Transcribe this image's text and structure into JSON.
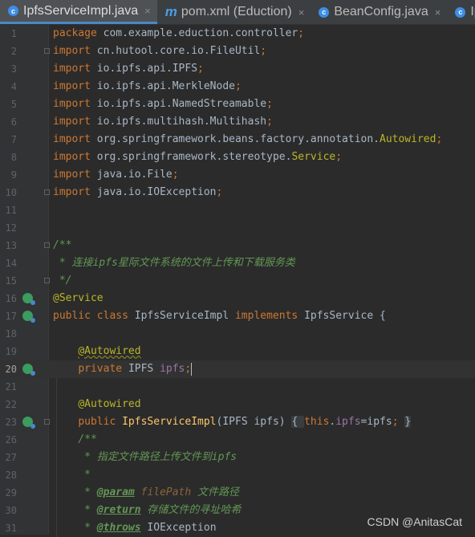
{
  "tabs": [
    {
      "label": "IpfsServiceImpl.java",
      "icon": "java-class-icon",
      "active": true
    },
    {
      "label": "pom.xml (Eduction)",
      "icon": "maven-icon",
      "active": false
    },
    {
      "label": "BeanConfig.java",
      "icon": "java-class-icon",
      "active": false
    },
    {
      "label": "Ipfs",
      "icon": "java-class-icon",
      "active": false
    }
  ],
  "close_glyph": "×",
  "editor": {
    "current_line": "20",
    "lines": [
      {
        "n": "1",
        "tokens": [
          {
            "t": "package ",
            "c": "kw"
          },
          {
            "t": "com.example.eduction.controller",
            "c": ""
          },
          {
            "t": ";",
            "c": "kw"
          }
        ]
      },
      {
        "n": "2",
        "tokens": [
          {
            "t": "import ",
            "c": "kw"
          },
          {
            "t": "cn.hutool.core.io.FileUtil",
            "c": ""
          },
          {
            "t": ";",
            "c": "kw"
          }
        ]
      },
      {
        "n": "3",
        "tokens": [
          {
            "t": "import ",
            "c": "kw"
          },
          {
            "t": "io.ipfs.api.IPFS",
            "c": ""
          },
          {
            "t": ";",
            "c": "kw"
          }
        ]
      },
      {
        "n": "4",
        "tokens": [
          {
            "t": "import ",
            "c": "kw"
          },
          {
            "t": "io.ipfs.api.MerkleNode",
            "c": ""
          },
          {
            "t": ";",
            "c": "kw"
          }
        ]
      },
      {
        "n": "5",
        "tokens": [
          {
            "t": "import ",
            "c": "kw"
          },
          {
            "t": "io.ipfs.api.NamedStreamable",
            "c": ""
          },
          {
            "t": ";",
            "c": "kw"
          }
        ]
      },
      {
        "n": "6",
        "tokens": [
          {
            "t": "import ",
            "c": "kw"
          },
          {
            "t": "io.ipfs.multihash.Multihash",
            "c": ""
          },
          {
            "t": ";",
            "c": "kw"
          }
        ]
      },
      {
        "n": "7",
        "tokens": [
          {
            "t": "import ",
            "c": "kw"
          },
          {
            "t": "org.springframework.beans.factory.annotation.",
            "c": ""
          },
          {
            "t": "Autowired",
            "c": "ann"
          },
          {
            "t": ";",
            "c": "kw"
          }
        ]
      },
      {
        "n": "8",
        "tokens": [
          {
            "t": "import ",
            "c": "kw"
          },
          {
            "t": "org.springframework.stereotype.",
            "c": ""
          },
          {
            "t": "Service",
            "c": "ann"
          },
          {
            "t": ";",
            "c": "kw"
          }
        ]
      },
      {
        "n": "9",
        "tokens": [
          {
            "t": "import ",
            "c": "kw"
          },
          {
            "t": "java.io.File",
            "c": ""
          },
          {
            "t": ";",
            "c": "kw"
          }
        ]
      },
      {
        "n": "10",
        "tokens": [
          {
            "t": "import ",
            "c": "kw"
          },
          {
            "t": "java.io.IOException",
            "c": ""
          },
          {
            "t": ";",
            "c": "kw"
          }
        ]
      },
      {
        "n": "11",
        "tokens": []
      },
      {
        "n": "12",
        "tokens": []
      },
      {
        "n": "13",
        "tokens": [
          {
            "t": "/**",
            "c": "cmt"
          }
        ]
      },
      {
        "n": "14",
        "tokens": [
          {
            "t": " * 连接ipfs星际文件系统的文件上传和下载服务类",
            "c": "cmt"
          }
        ]
      },
      {
        "n": "15",
        "tokens": [
          {
            "t": " */",
            "c": "cmt"
          }
        ]
      },
      {
        "n": "16",
        "tokens": [
          {
            "t": "@Service",
            "c": "ann"
          }
        ]
      },
      {
        "n": "17",
        "tokens": [
          {
            "t": "public class ",
            "c": "kw"
          },
          {
            "t": "IpfsServiceImpl ",
            "c": ""
          },
          {
            "t": "implements ",
            "c": "kw"
          },
          {
            "t": "IpfsService {",
            "c": ""
          }
        ]
      },
      {
        "n": "18",
        "tokens": []
      },
      {
        "n": "19",
        "tokens": [
          {
            "t": "    ",
            "c": ""
          },
          {
            "t": "@Autowired",
            "c": "ann err"
          }
        ]
      },
      {
        "n": "20",
        "tokens": [
          {
            "t": "    ",
            "c": ""
          },
          {
            "t": "private ",
            "c": "kw"
          },
          {
            "t": "IPFS ",
            "c": ""
          },
          {
            "t": "ipfs",
            "c": "fld"
          },
          {
            "t": ";",
            "c": "kw"
          }
        ]
      },
      {
        "n": "21",
        "tokens": []
      },
      {
        "n": "22",
        "tokens": [
          {
            "t": "    ",
            "c": ""
          },
          {
            "t": "@Autowired",
            "c": "ann"
          }
        ]
      },
      {
        "n": "23",
        "tokens": [
          {
            "t": "    ",
            "c": ""
          },
          {
            "t": "public ",
            "c": "kw"
          },
          {
            "t": "IpfsServiceImpl",
            "c": "fn"
          },
          {
            "t": "(IPFS ipfs) ",
            "c": ""
          },
          {
            "t": "{ ",
            "c": "foldbox"
          },
          {
            "t": "this",
            "c": "kw"
          },
          {
            "t": ".",
            "c": ""
          },
          {
            "t": "ipfs",
            "c": "fld"
          },
          {
            "t": "=ipfs",
            "c": ""
          },
          {
            "t": "; ",
            "c": "kw"
          },
          {
            "t": "}",
            "c": "foldbox"
          }
        ]
      },
      {
        "n": "26",
        "tokens": [
          {
            "t": "    ",
            "c": ""
          },
          {
            "t": "/**",
            "c": "cmt"
          }
        ]
      },
      {
        "n": "27",
        "tokens": [
          {
            "t": "     * 指定文件路径上传文件到ipfs",
            "c": "cmt"
          }
        ]
      },
      {
        "n": "28",
        "tokens": [
          {
            "t": "     *",
            "c": "cmt"
          }
        ]
      },
      {
        "n": "29",
        "tokens": [
          {
            "t": "     * ",
            "c": "cmt"
          },
          {
            "t": "@param",
            "c": "tag"
          },
          {
            "t": " ",
            "c": "cmt"
          },
          {
            "t": "filePath",
            "c": "pname"
          },
          {
            "t": " 文件路径",
            "c": "cmt"
          }
        ]
      },
      {
        "n": "30",
        "tokens": [
          {
            "t": "     * ",
            "c": "cmt"
          },
          {
            "t": "@return",
            "c": "tag"
          },
          {
            "t": " 存储文件的寻址哈希",
            "c": "cmt"
          }
        ]
      },
      {
        "n": "31",
        "tokens": [
          {
            "t": "     * ",
            "c": "cmt"
          },
          {
            "t": "@throws",
            "c": "tag"
          },
          {
            "t": " ",
            "c": "cmt"
          },
          {
            "t": "IOException",
            "c": ""
          }
        ]
      }
    ],
    "fold_markers": [
      "2",
      "10",
      "13",
      "15",
      "23"
    ],
    "gutter_icons": [
      {
        "line": "16",
        "icon": "spring-bean-icon"
      },
      {
        "line": "17",
        "icon": "spring-bean-implements-icon"
      },
      {
        "line": "20",
        "icon": "spring-autowired-icon"
      },
      {
        "line": "23",
        "icon": "spring-autowired-icon"
      }
    ]
  },
  "watermark": "CSDN @AnitasCat"
}
